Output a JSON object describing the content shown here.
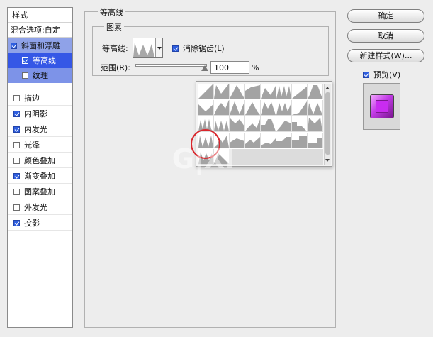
{
  "sidebar": {
    "header": "样式",
    "blend_options": "混合选项:自定",
    "items": [
      {
        "label": "斜面和浮雕",
        "checked": true
      },
      {
        "label": "等高线",
        "checked": true
      },
      {
        "label": "纹理",
        "checked": false
      },
      {
        "label": "描边",
        "checked": false
      },
      {
        "label": "内阴影",
        "checked": true
      },
      {
        "label": "内发光",
        "checked": true
      },
      {
        "label": "光泽",
        "checked": false
      },
      {
        "label": "颜色叠加",
        "checked": false
      },
      {
        "label": "渐变叠加",
        "checked": true
      },
      {
        "label": "图案叠加",
        "checked": false
      },
      {
        "label": "外发光",
        "checked": false
      },
      {
        "label": "投影",
        "checked": true
      }
    ]
  },
  "panel": {
    "title": "等高线",
    "group_title": "图素",
    "contour_label": "等高线:",
    "antialias_label": "消除锯齿(L)",
    "antialias_checked": true,
    "range_label": "范围(R):",
    "range_value": "100",
    "range_unit": "%",
    "range_fraction": 1.0
  },
  "buttons": {
    "ok": "确定",
    "cancel": "取消",
    "new_style": "新建样式(W)...",
    "preview_label": "预览(V)",
    "preview_checked": true
  },
  "colors": {
    "selection_main": "#8fa2e8",
    "selection_sub": "#3557e6",
    "highlight_circle": "#d9262c",
    "preview_tile": "#c92cf0"
  },
  "picker": {
    "columns": 8,
    "rows": 5,
    "highlighted_index": 24,
    "filled_count": 34
  },
  "watermark": "G|XI"
}
